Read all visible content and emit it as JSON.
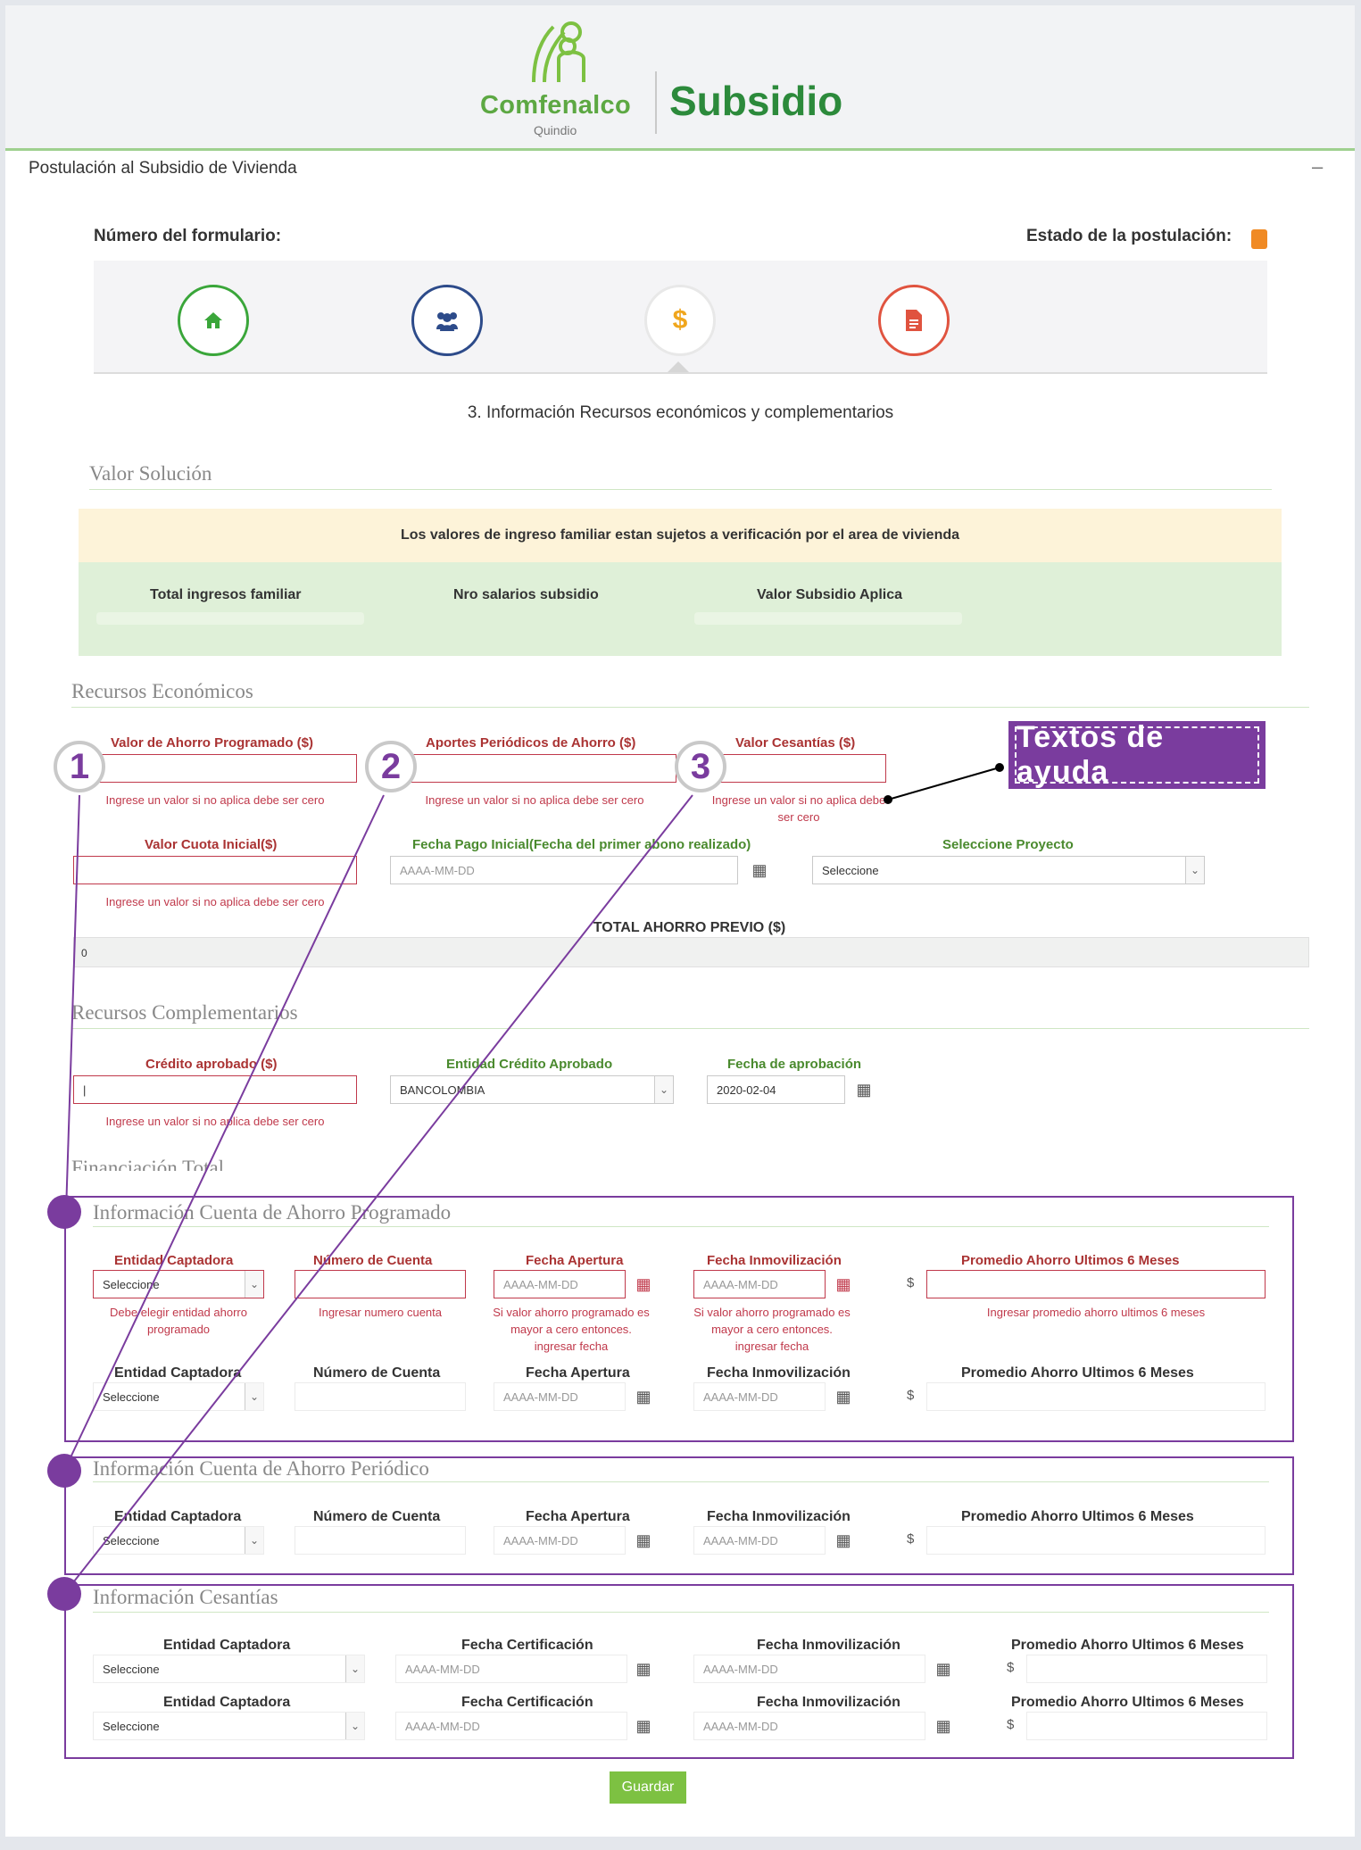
{
  "brand": {
    "name": "Comfenalco",
    "region": "Quindio",
    "product": "Subsidio"
  },
  "panel": {
    "title": "Postulación al Subsidio de Vivienda",
    "collapse": "–"
  },
  "form_header": {
    "numero_label": "Número del formulario:",
    "estado_label": "Estado de la postulación:",
    "estado_color": "#f08a24"
  },
  "steps": [
    {
      "icon": "home-icon",
      "glyph": "⌂",
      "color": "#3aa63a"
    },
    {
      "icon": "users-icon",
      "glyph": "👥",
      "color": "#2d4b8a"
    },
    {
      "icon": "dollar-icon",
      "glyph": "$",
      "color": "#f0a61d"
    },
    {
      "icon": "document-icon",
      "glyph": "▤",
      "color": "#e0533f"
    }
  ],
  "step_title": "3. Información Recursos económicos y complementarios",
  "valor_solucion": {
    "title": "Valor Solución",
    "alert": "Los valores de ingreso familiar estan sujetos a verificación por el area de vivienda",
    "col1": "Total ingresos familiar",
    "col2": "Nro salarios subsidio",
    "col3": "Valor Subsidio Aplica"
  },
  "recursos_economicos": {
    "title": "Recursos Económicos",
    "ahorro_label": "Valor de Ahorro Programado ($)",
    "aportes_label": "Aportes Periódicos de Ahorro ($)",
    "cesantias_label": "Valor Cesantías ($)",
    "help_zero": "Ingrese un valor si no aplica debe ser cero",
    "help_zero_a": "Ingrese un valor si no aplica debe",
    "help_zero_b": "ser cero",
    "cuota_label": "Valor Cuota Inicial($)",
    "fecha_pago_label": "Fecha Pago Inicial(Fecha del primer abono realizado)",
    "fecha_placeholder": "AAAA-MM-DD",
    "proyecto_label": "Seleccione Proyecto",
    "proyecto_value": "Seleccione",
    "total_label": "TOTAL AHORRO PREVIO ($)",
    "total_value": "0"
  },
  "recursos_complementarios": {
    "title": "Recursos Complementarios",
    "credito_label": "Crédito aprobado ($)",
    "entidad_label": "Entidad Crédito Aprobado",
    "entidad_value": "BANCOLOMBIA",
    "fecha_label": "Fecha de aprobación",
    "fecha_value": "2020-02-04",
    "help": "Ingrese un valor si no aplica debe ser cero"
  },
  "financiacion": {
    "title": "Financiación Total"
  },
  "cuenta_programado": {
    "title": "Información Cuenta de Ahorro Programado",
    "entidad": "Entidad Captadora",
    "numero": "Número de Cuenta",
    "fecha_apertura": "Fecha Apertura",
    "fecha_inmov": "Fecha Inmovilización",
    "promedio": "Promedio Ahorro Ultimos 6 Meses",
    "select_value": "Seleccione",
    "date_placeholder": "AAAA-MM-DD",
    "dollar": "$",
    "err_entidad_a": "Debe elegir entidad ahorro",
    "err_entidad_b": "programado",
    "err_numero": "Ingresar numero cuenta",
    "err_fecha_a": "Si valor ahorro programado es",
    "err_fecha_b": "mayor a cero entonces.",
    "err_fecha_c": "ingresar fecha",
    "err_promedio": "Ingresar promedio ahorro ultimos 6 meses"
  },
  "cuenta_periodico": {
    "title": "Información Cuenta de Ahorro Periódico",
    "entidad": "Entidad Captadora",
    "numero": "Número de Cuenta",
    "fecha_apertura": "Fecha Apertura",
    "fecha_inmov": "Fecha Inmovilización",
    "promedio": "Promedio Ahorro Ultimos 6 Meses",
    "select_value": "Seleccione",
    "date_placeholder": "AAAA-MM-DD",
    "dollar": "$"
  },
  "cesantias": {
    "title": "Información Cesantías",
    "entidad": "Entidad Captadora",
    "fecha_cert": "Fecha Certificación",
    "fecha_inmov": "Fecha Inmovilización",
    "promedio": "Promedio Ahorro Ultimos 6 Meses",
    "select_value": "Seleccione",
    "date_placeholder": "AAAA-MM-DD",
    "dollar": "$"
  },
  "annotations": {
    "help_tag": "Textos de ayuda",
    "n1": "1",
    "n2": "2",
    "n3": "3",
    "color": "#7a3c9e"
  },
  "save_button": "Guardar"
}
